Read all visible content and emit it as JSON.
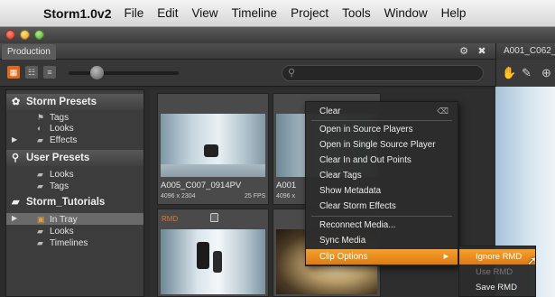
{
  "menubar": {
    "app_name": "Storm1.0v2",
    "items": [
      "File",
      "Edit",
      "View",
      "Timeline",
      "Project",
      "Tools",
      "Window",
      "Help"
    ]
  },
  "panel": {
    "tab_label": "Production"
  },
  "right_panel": {
    "tab_label": "A001_C062_"
  },
  "sidebar": {
    "sections": [
      {
        "title": "Storm Presets",
        "items": [
          "Tags",
          "Looks",
          "Effects"
        ]
      },
      {
        "title": "User Presets",
        "items": [
          "Looks",
          "Tags"
        ]
      },
      {
        "title": "Storm_Tutorials",
        "items": [
          "In Tray",
          "Looks",
          "Timelines"
        ]
      }
    ]
  },
  "clips": [
    {
      "name": "A005_C007_0914PV",
      "resolution": "4096 x 2304",
      "fps": "25 FPS"
    },
    {
      "name": "A001",
      "resolution": "4096 x",
      "fps": ""
    },
    {
      "badge": "RMD"
    }
  ],
  "context_menu": {
    "items": [
      "Clear",
      "Open in Source Players",
      "Open in Single Source Player",
      "Clear In and Out Points",
      "Clear Tags",
      "Show Metadata",
      "Clear Storm Effects",
      "Reconnect Media...",
      "Sync Media",
      "Clip Options"
    ],
    "clear_key": "⌫"
  },
  "submenu": {
    "items": [
      "Ignore RMD",
      "Use RMD",
      "Save RMD"
    ]
  },
  "colors": {
    "accent": "#e0691a",
    "menu_highlight": "#f0952a"
  }
}
